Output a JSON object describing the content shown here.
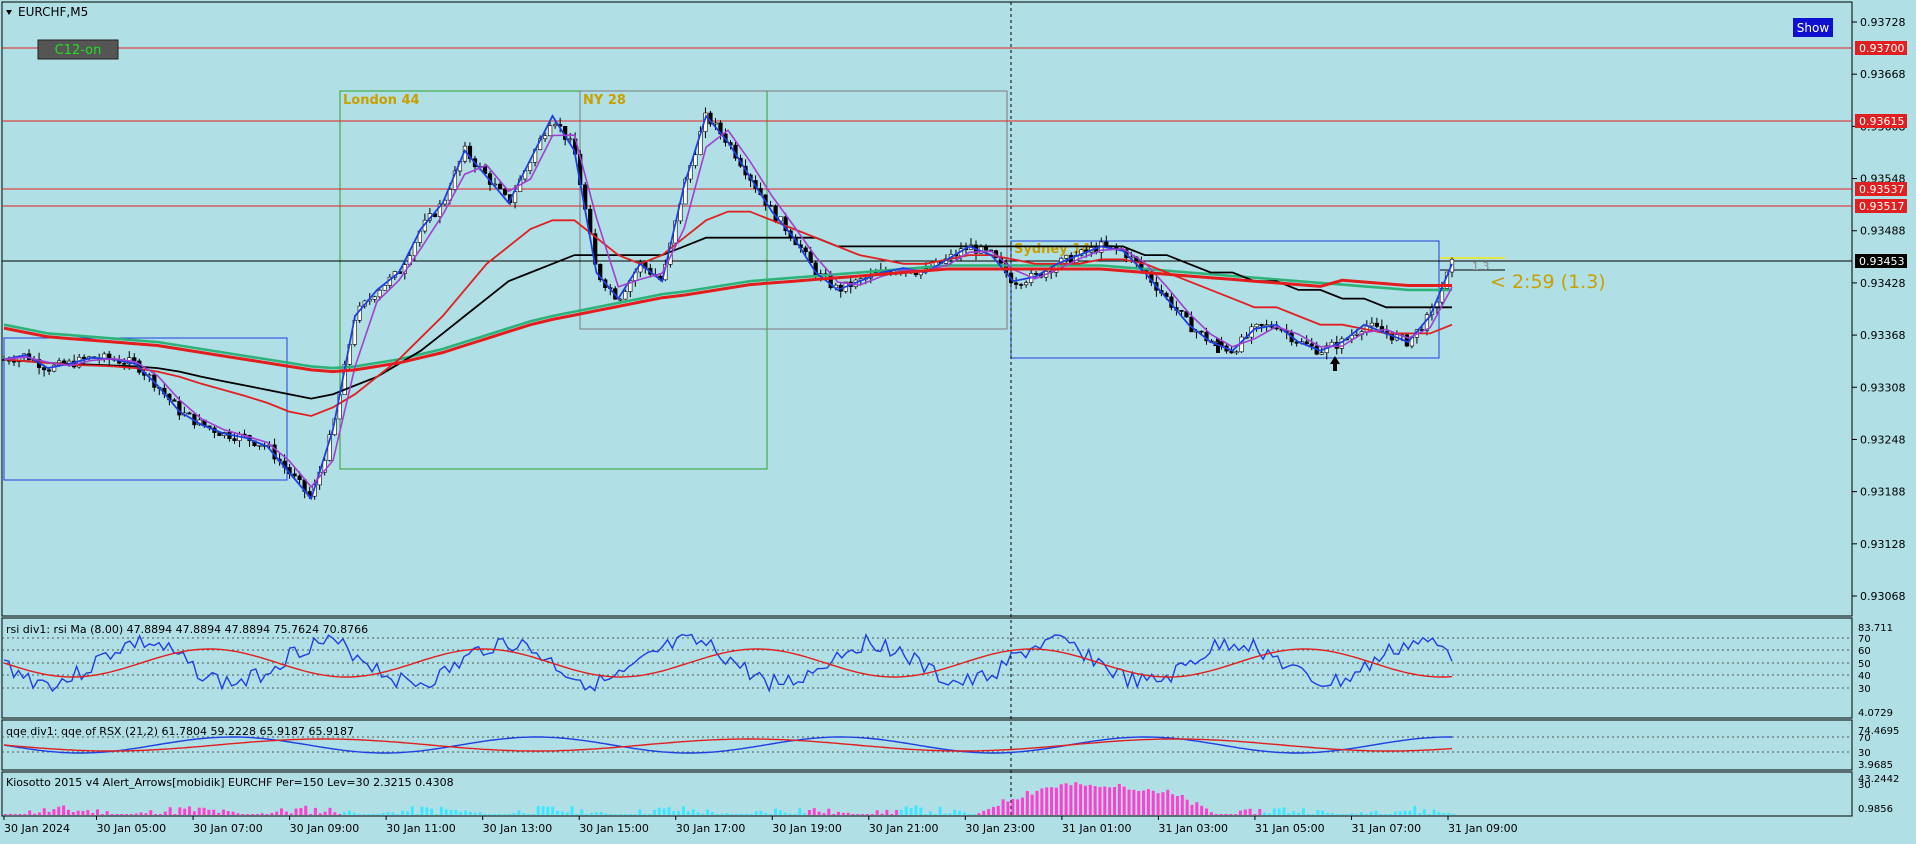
{
  "window": {
    "symbol_title": "EURCHF,M5",
    "show_button": "Show",
    "c12_label": "C12-on"
  },
  "colors": {
    "background": "#b0dfe5",
    "up_line": "#1f3fe0",
    "down_line": "#e02020",
    "sma": "#000000",
    "ema_green": "#2db37a",
    "ema_red": "#e21d1d",
    "pink_hist": "#ff3fcf",
    "cyan_hist": "#3fe6ff"
  },
  "sessions": [
    {
      "label": "London 44",
      "color": "#2ca02c"
    },
    {
      "label": "NY 28",
      "color": "#c8a000"
    },
    {
      "label": "Sydney 14",
      "color": "#c8a000"
    }
  ],
  "price_axis": {
    "ticks": [
      "0.93728",
      "0.93668",
      "0.93608",
      "0.93548",
      "0.93488",
      "0.93428",
      "0.93368",
      "0.93308",
      "0.93248",
      "0.93188",
      "0.93128",
      "0.93068"
    ]
  },
  "price_levels": [
    {
      "value": "0.93700",
      "type": "resistance"
    },
    {
      "value": "0.93615",
      "type": "resistance"
    },
    {
      "value": "0.93537",
      "type": "resistance"
    },
    {
      "value": "0.93517",
      "type": "resistance"
    },
    {
      "value": "0.93453",
      "type": "current"
    }
  ],
  "countdown": {
    "text": "< 2:59 (1.3)",
    "small": "1.3"
  },
  "time_axis": {
    "labels": [
      "30 Jan 2024",
      "30 Jan 05:00",
      "30 Jan 07:00",
      "30 Jan 09:00",
      "30 Jan 11:00",
      "30 Jan 13:00",
      "30 Jan 15:00",
      "30 Jan 17:00",
      "30 Jan 19:00",
      "30 Jan 21:00",
      "30 Jan 23:00",
      "31 Jan 01:00",
      "31 Jan 03:00",
      "31 Jan 05:00",
      "31 Jan 07:00",
      "31 Jan 09:00"
    ]
  },
  "indicators": {
    "rsi": {
      "title": "rsi div1: rsi Ma (8.00) 47.8894 47.8894 47.8894 75.7624 70.8766",
      "ticks": [
        "83.711",
        "70",
        "60",
        "50",
        "40",
        "30",
        "4.0729"
      ]
    },
    "rsx": {
      "title": "qqe div1: qqe of RSX (21,2) 61.7804 59.2228 65.9187 65.9187",
      "ticks": [
        "74.4695",
        "70",
        "30",
        "3.9685"
      ]
    },
    "kiosotto": {
      "title": "Kiosotto 2015 v4 Alert_Arrows[mobidik] EURCHF Per=150 Lev=30 2.3215 0.4308",
      "ticks": [
        "43.2442",
        "30",
        "0.9856"
      ]
    }
  },
  "chart_data": {
    "type": "line",
    "title": "EURCHF,M5",
    "x_labels": [
      "30 Jan 2024",
      "30 Jan 05:00",
      "30 Jan 07:00",
      "30 Jan 09:00",
      "30 Jan 11:00",
      "30 Jan 13:00",
      "30 Jan 15:00",
      "30 Jan 17:00",
      "30 Jan 19:00",
      "30 Jan 21:00",
      "30 Jan 23:00",
      "31 Jan 01:00",
      "31 Jan 03:00",
      "31 Jan 05:00",
      "31 Jan 07:00",
      "31 Jan 09:00"
    ],
    "ylim": [
      0.93068,
      0.93728
    ],
    "series": [
      {
        "values": [
          0.9334,
          0.93345,
          0.9333,
          0.93335,
          0.93342,
          0.9334,
          0.93335,
          0.9331,
          0.9328,
          0.93265,
          0.93255,
          0.9325,
          0.9324,
          0.9321,
          0.9318,
          0.9326,
          0.9339,
          0.9342,
          0.9344,
          0.9349,
          0.9352,
          0.9358,
          0.9355,
          0.9352,
          0.9357,
          0.9362,
          0.9358,
          0.9344,
          0.9341,
          0.9345,
          0.9343,
          0.9354,
          0.9362,
          0.9359,
          0.9355,
          0.9351,
          0.9348,
          0.9344,
          0.9342,
          0.9343,
          0.9344,
          0.93445,
          0.9344,
          0.93455,
          0.9347,
          0.9346,
          0.9343,
          0.93435,
          0.9345,
          0.9346,
          0.9347,
          0.93465,
          0.9344,
          0.9341,
          0.9338,
          0.9336,
          0.9335,
          0.93375,
          0.9338,
          0.9336,
          0.9335,
          0.9336,
          0.9338,
          0.9337,
          0.9336,
          0.9339,
          0.9345
        ]
      },
      {
        "values": [
          0.9334,
          0.93338,
          0.93336,
          0.93334,
          0.93333,
          0.93332,
          0.9333,
          0.93326,
          0.9332,
          0.93312,
          0.93305,
          0.93298,
          0.9329,
          0.9328,
          0.93275,
          0.93285,
          0.933,
          0.9332,
          0.9334,
          0.93365,
          0.9339,
          0.9342,
          0.9345,
          0.9347,
          0.9349,
          0.935,
          0.935,
          0.9348,
          0.9346,
          0.9345,
          0.9346,
          0.9348,
          0.935,
          0.9351,
          0.9351,
          0.935,
          0.9349,
          0.9348,
          0.9347,
          0.9346,
          0.93455,
          0.9345,
          0.9345,
          0.93455,
          0.9346,
          0.9346,
          0.93455,
          0.9345,
          0.9345,
          0.9345,
          0.93455,
          0.93455,
          0.9345,
          0.9344,
          0.9343,
          0.9342,
          0.9341,
          0.934,
          0.934,
          0.9339,
          0.9338,
          0.9338,
          0.93375,
          0.9337,
          0.9337,
          0.9337,
          0.9338
        ]
      },
      {
        "values": [
          0.9334,
          0.93338,
          0.93336,
          0.93335,
          0.93334,
          0.93333,
          0.93332,
          0.9333,
          0.93326,
          0.9332,
          0.93315,
          0.9331,
          0.93305,
          0.933,
          0.93295,
          0.933,
          0.9331,
          0.9332,
          0.93335,
          0.9335,
          0.9337,
          0.9339,
          0.9341,
          0.9343,
          0.9344,
          0.9345,
          0.9346,
          0.9346,
          0.9346,
          0.9346,
          0.9346,
          0.9347,
          0.9348,
          0.9348,
          0.9348,
          0.9348,
          0.9348,
          0.9348,
          0.9347,
          0.9347,
          0.9347,
          0.9347,
          0.9347,
          0.9347,
          0.9347,
          0.9347,
          0.9347,
          0.9347,
          0.9347,
          0.9347,
          0.9347,
          0.9347,
          0.9346,
          0.9346,
          0.9345,
          0.9344,
          0.9344,
          0.9343,
          0.9343,
          0.9342,
          0.9342,
          0.9341,
          0.9341,
          0.934,
          0.934,
          0.934,
          0.934
        ]
      },
      {
        "values": [
          0.9338,
          0.93375,
          0.9337,
          0.93368,
          0.93366,
          0.93364,
          0.93362,
          0.9336,
          0.93356,
          0.93352,
          0.93348,
          0.93344,
          0.9334,
          0.93336,
          0.93332,
          0.9333,
          0.93332,
          0.93336,
          0.9334,
          0.93346,
          0.93352,
          0.9336,
          0.93368,
          0.93376,
          0.93384,
          0.9339,
          0.93395,
          0.934,
          0.93405,
          0.9341,
          0.93415,
          0.93418,
          0.93422,
          0.93426,
          0.9343,
          0.93432,
          0.93434,
          0.93436,
          0.93438,
          0.9344,
          0.93442,
          0.93444,
          0.93446,
          0.93448,
          0.93448,
          0.93448,
          0.93448,
          0.93448,
          0.93448,
          0.93448,
          0.93448,
          0.93446,
          0.93444,
          0.93442,
          0.9344,
          0.93438,
          0.93436,
          0.93434,
          0.93432,
          0.9343,
          0.93428,
          0.93426,
          0.93424,
          0.93422,
          0.9342,
          0.9342,
          0.9342
        ]
      }
    ]
  }
}
